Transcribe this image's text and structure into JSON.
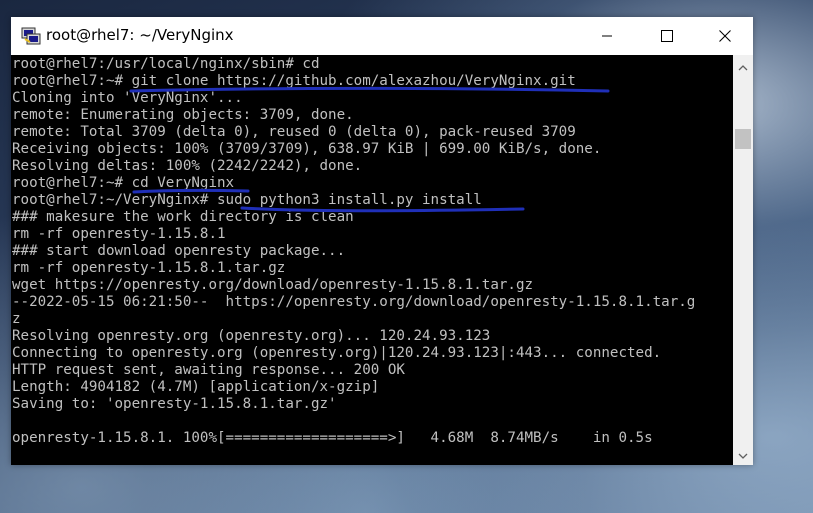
{
  "window": {
    "title": "root@rhel7: ~/VeryNginx"
  },
  "terminal": {
    "lines": [
      "root@rhel7:/usr/local/nginx/sbin# cd",
      "root@rhel7:~# git clone https://github.com/alexazhou/VeryNginx.git",
      "Cloning into 'VeryNginx'...",
      "remote: Enumerating objects: 3709, done.",
      "remote: Total 3709 (delta 0), reused 0 (delta 0), pack-reused 3709",
      "Receiving objects: 100% (3709/3709), 638.97 KiB | 699.00 KiB/s, done.",
      "Resolving deltas: 100% (2242/2242), done.",
      "root@rhel7:~# cd VeryNginx",
      "root@rhel7:~/VeryNginx# sudo python3 install.py install",
      "### makesure the work directory is clean",
      "rm -rf openresty-1.15.8.1",
      "### start download openresty package...",
      "rm -rf openresty-1.15.8.1.tar.gz",
      "wget https://openresty.org/download/openresty-1.15.8.1.tar.gz",
      "--2022-05-15 06:21:50--  https://openresty.org/download/openresty-1.15.8.1.tar.g",
      "z",
      "Resolving openresty.org (openresty.org)... 120.24.93.123",
      "Connecting to openresty.org (openresty.org)|120.24.93.123|:443... connected.",
      "HTTP request sent, awaiting response... 200 OK",
      "Length: 4904182 (4.7M) [application/x-gzip]",
      "Saving to: 'openresty-1.15.8.1.tar.gz'",
      "",
      "openresty-1.15.8.1. 100%[===================>]   4.68M  8.74MB/s    in 0.5s"
    ]
  },
  "colors": {
    "terminal_bg": "#000000",
    "terminal_fg": "#c0c0c0",
    "annotation_stroke": "#1f2fb8",
    "titlebar_bg": "#ffffff"
  },
  "icons": {
    "app": "putty-icon",
    "minimize": "minimize-icon",
    "maximize": "maximize-icon",
    "close": "close-icon",
    "scroll_up": "scroll-up-arrow-icon",
    "scroll_down": "scroll-down-arrow-icon"
  }
}
